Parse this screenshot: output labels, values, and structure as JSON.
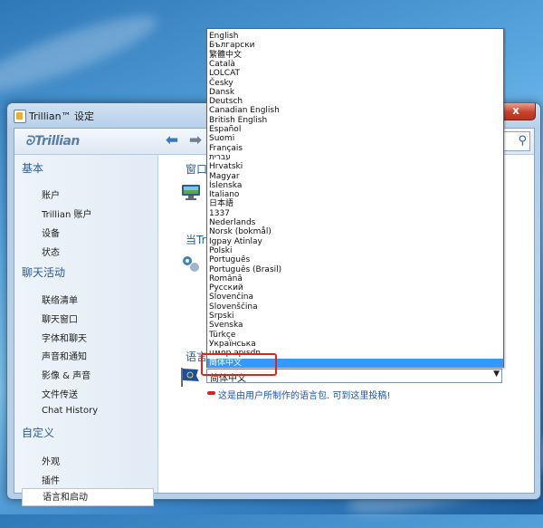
{
  "window": {
    "title": "Trillian™ 设定",
    "close_label": "x"
  },
  "toolbar": {
    "logo": "Trillian"
  },
  "sidebar": {
    "categories": [
      {
        "label": "基本",
        "items": [
          "账户",
          "Trillian 账户",
          "设备",
          "状态"
        ]
      },
      {
        "label": "聊天活动",
        "items": [
          "联络清单",
          "聊天窗口",
          "字体和聊天",
          "声音和通知",
          "影像 & 声音",
          "文件传送",
          "Chat History"
        ]
      },
      {
        "label": "自定义",
        "items": [
          "外观",
          "插件",
          "语言和启动"
        ]
      }
    ],
    "selected": "语言和启动"
  },
  "main": {
    "section1": "窗口显",
    "section2": "当Tril",
    "section3": "语言",
    "language_value": "简体中文",
    "language_note": "这是由用户所制作的语言包. 可到这里投稿!"
  },
  "dropdown": {
    "options": [
      "English",
      "Български",
      "繁體中文",
      "Català",
      "LOLCAT",
      "Česky",
      "Dansk",
      "Deutsch",
      "Canadian English",
      "British English",
      "Español",
      "Suomi",
      "Français",
      "עברית",
      "Hrvatski",
      "Magyar",
      "Íslenska",
      "Italiano",
      "日本語",
      "1337",
      "Nederlands",
      "Norsk (bokmål)",
      "Igpay Atinlay",
      "Polski",
      "Português",
      "Português (Brasil)",
      "Română",
      "Русский",
      "Slovenčina",
      "Slovenščina",
      "Srpski",
      "Svenska",
      "Türkçe",
      "Українська",
      "uʍop ǝpısdn",
      "简体中文"
    ],
    "highlighted": "简体中文"
  },
  "colors": {
    "accent": "#2c5c93",
    "selection": "#3399ff",
    "annotation": "#e0231d"
  }
}
